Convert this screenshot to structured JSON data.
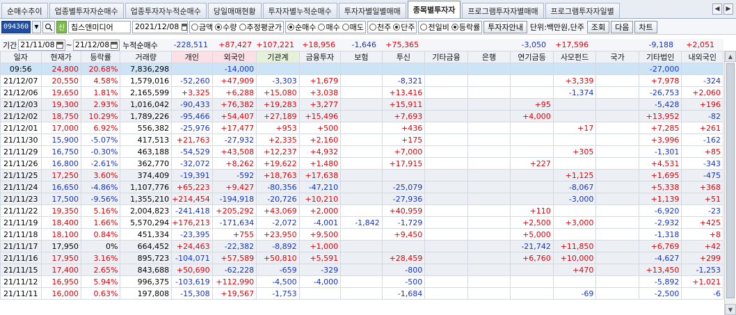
{
  "tabs": [
    "순매수추이",
    "업종별투자자순매수",
    "업종투자자누적순매수",
    "당일매매현황",
    "투자자별누적순매수",
    "투자자별일별매매",
    "종목별투자자",
    "프로그램투자자별매매",
    "프로그램투자자일별"
  ],
  "active_tab": 6,
  "toolbar": {
    "code": "094360",
    "badge": "신",
    "name": "칩스앤미디어",
    "date": "2021/12/08",
    "radio_amount": [
      {
        "label": "금액",
        "on": false
      },
      {
        "label": "수량",
        "on": true
      },
      {
        "label": "추정평균가",
        "on": false
      }
    ],
    "radio_side": [
      {
        "label": "순매수",
        "on": true
      },
      {
        "label": "매수",
        "on": false
      },
      {
        "label": "매도",
        "on": false
      }
    ],
    "radio_unit": [
      {
        "label": "천주",
        "on": false
      },
      {
        "label": "단주",
        "on": true
      }
    ],
    "radio_cmp": [
      {
        "label": "전일비",
        "on": false
      },
      {
        "label": "등락률",
        "on": true
      }
    ],
    "guide_button": "투자자안내",
    "unit_text": "단위:백만원,단주",
    "search_button": "조회",
    "next_button": "다음",
    "chart_button": "차트"
  },
  "period": {
    "label": "기간",
    "from": "21/11/08",
    "to": "21/12/08",
    "cum_label": "누적순매수",
    "sums": [
      "-228,511",
      "+87,427",
      "+107,221",
      "+18,956",
      "-1,646",
      "+75,365",
      "",
      "",
      "-3,050",
      "+17,596",
      "",
      "-9,188",
      "+2,051"
    ]
  },
  "columns": [
    "일자",
    "현재가",
    "등락률",
    "거래량",
    "개인",
    "외국인",
    "기관계",
    "금융투자",
    "보험",
    "투신",
    "기타금융",
    "은행",
    "연기금등",
    "사모펀드",
    "국가",
    "기타법인",
    "내외국인"
  ],
  "rows": [
    [
      "09:56",
      "24,800",
      "20.68%",
      "7,836,298",
      "",
      "-14,000",
      "",
      "",
      "",
      "",
      "",
      "",
      "",
      "",
      "",
      "-27,000",
      ""
    ],
    [
      "21/12/07",
      "20,550",
      "4.58%",
      "1,579,016",
      "-52,260",
      "+47,909",
      "-3,303",
      "+1,679",
      "",
      "-8,321",
      "",
      "",
      "",
      "+3,339",
      "",
      "+7,978",
      "-324"
    ],
    [
      "21/12/06",
      "19,650",
      "1.81%",
      "2,165,599",
      "+3,325",
      "+6,288",
      "+15,080",
      "+3,038",
      "",
      "+13,416",
      "",
      "",
      "",
      "-1,374",
      "",
      "-26,753",
      "+2,060"
    ],
    [
      "21/12/03",
      "19,300",
      "2.93%",
      "1,016,042",
      "-90,433",
      "+76,382",
      "+19,283",
      "+3,277",
      "",
      "+15,911",
      "",
      "",
      "+95",
      "",
      "",
      "-5,428",
      "+196"
    ],
    [
      "21/12/02",
      "18,750",
      "10.29%",
      "1,789,226",
      "-95,466",
      "+54,407",
      "+27,189",
      "+15,496",
      "",
      "+7,693",
      "",
      "",
      "+4,000",
      "",
      "",
      "+13,952",
      "-82"
    ],
    [
      "21/12/01",
      "17,000",
      "6.92%",
      "556,382",
      "-25,976",
      "+17,477",
      "+953",
      "+500",
      "",
      "+436",
      "",
      "",
      "",
      "+17",
      "",
      "+7,285",
      "+261"
    ],
    [
      "21/11/30",
      "15,900",
      "-5.07%",
      "417,513",
      "+21,763",
      "-27,932",
      "+2,335",
      "+2,160",
      "",
      "+175",
      "",
      "",
      "",
      "",
      "",
      "+3,996",
      "-162"
    ],
    [
      "21/11/29",
      "16,750",
      "-0.30%",
      "463,188",
      "-54,529",
      "+43,508",
      "+12,237",
      "+4,932",
      "",
      "+7,000",
      "",
      "",
      "",
      "+305",
      "",
      "-1,301",
      "+85"
    ],
    [
      "21/11/26",
      "16,800",
      "-2.61%",
      "362,770",
      "-32,072",
      "+8,262",
      "+19,622",
      "+1,480",
      "",
      "+17,915",
      "",
      "",
      "+227",
      "",
      "",
      "+4,531",
      "-343"
    ],
    [
      "21/11/25",
      "17,250",
      "3.60%",
      "374,409",
      "-19,391",
      "-592",
      "+18,763",
      "+17,638",
      "",
      "",
      "",
      "",
      "",
      "+1,125",
      "",
      "+1,695",
      "-475"
    ],
    [
      "21/11/24",
      "16,650",
      "-4.86%",
      "1,107,776",
      "+65,223",
      "+9,427",
      "-80,356",
      "-47,210",
      "",
      "-25,079",
      "",
      "",
      "",
      "-8,067",
      "",
      "+5,338",
      "+368"
    ],
    [
      "21/11/23",
      "17,500",
      "-9.56%",
      "1,355,210",
      "+214,454",
      "-194,918",
      "-20,726",
      "+10,210",
      "",
      "-27,936",
      "",
      "",
      "",
      "-3,000",
      "",
      "+1,139",
      "+51"
    ],
    [
      "21/11/22",
      "19,350",
      "5.16%",
      "2,004,823",
      "-241,418",
      "+205,292",
      "+43,069",
      "+2,000",
      "",
      "+40,959",
      "",
      "",
      "+110",
      "",
      "",
      "-6,920",
      "-23"
    ],
    [
      "21/11/19",
      "18,400",
      "1.66%",
      "5,570,294",
      "+176,213",
      "-171,634",
      "-2,072",
      "-4,001",
      "-1,842",
      "-1,729",
      "",
      "",
      "+2,500",
      "+3,000",
      "",
      "-2,932",
      "+425"
    ],
    [
      "21/11/18",
      "18,100",
      "0.84%",
      "451,334",
      "-23,395",
      "+755",
      "+23,950",
      "+9,500",
      "",
      "+9,450",
      "",
      "",
      "+5,000",
      "",
      "",
      "-1,318",
      "+8"
    ],
    [
      "21/11/17",
      "17,950",
      "0%",
      "664,452",
      "+24,463",
      "-22,382",
      "-8,892",
      "+1,000",
      "",
      "",
      "",
      "",
      "-21,742",
      "+11,850",
      "",
      "+6,769",
      "+42"
    ],
    [
      "21/11/16",
      "17,950",
      "3.16%",
      "895,723",
      "-104,071",
      "+57,589",
      "+50,810",
      "+5,591",
      "",
      "+28,459",
      "",
      "",
      "+6,760",
      "+10,000",
      "",
      "-4,627",
      "+299"
    ],
    [
      "21/11/15",
      "17,400",
      "2.65%",
      "843,688",
      "+50,690",
      "-62,228",
      "-659",
      "-329",
      "",
      "-800",
      "",
      "",
      "",
      "+470",
      "",
      "+13,450",
      "-1,253"
    ],
    [
      "21/11/12",
      "16,950",
      "5.94%",
      "996,375",
      "-103,619",
      "+112,990",
      "-4,500",
      "-4,000",
      "",
      "-500",
      "",
      "",
      "",
      "",
      "",
      "-5,892",
      "+1,021"
    ],
    [
      "21/11/11",
      "16,000",
      "0.63%",
      "197,808",
      "-15,308",
      "+19,567",
      "-1,753",
      "",
      "",
      "-1,684",
      "",
      "",
      "",
      "-69",
      "",
      "-2,500",
      "-6"
    ]
  ]
}
